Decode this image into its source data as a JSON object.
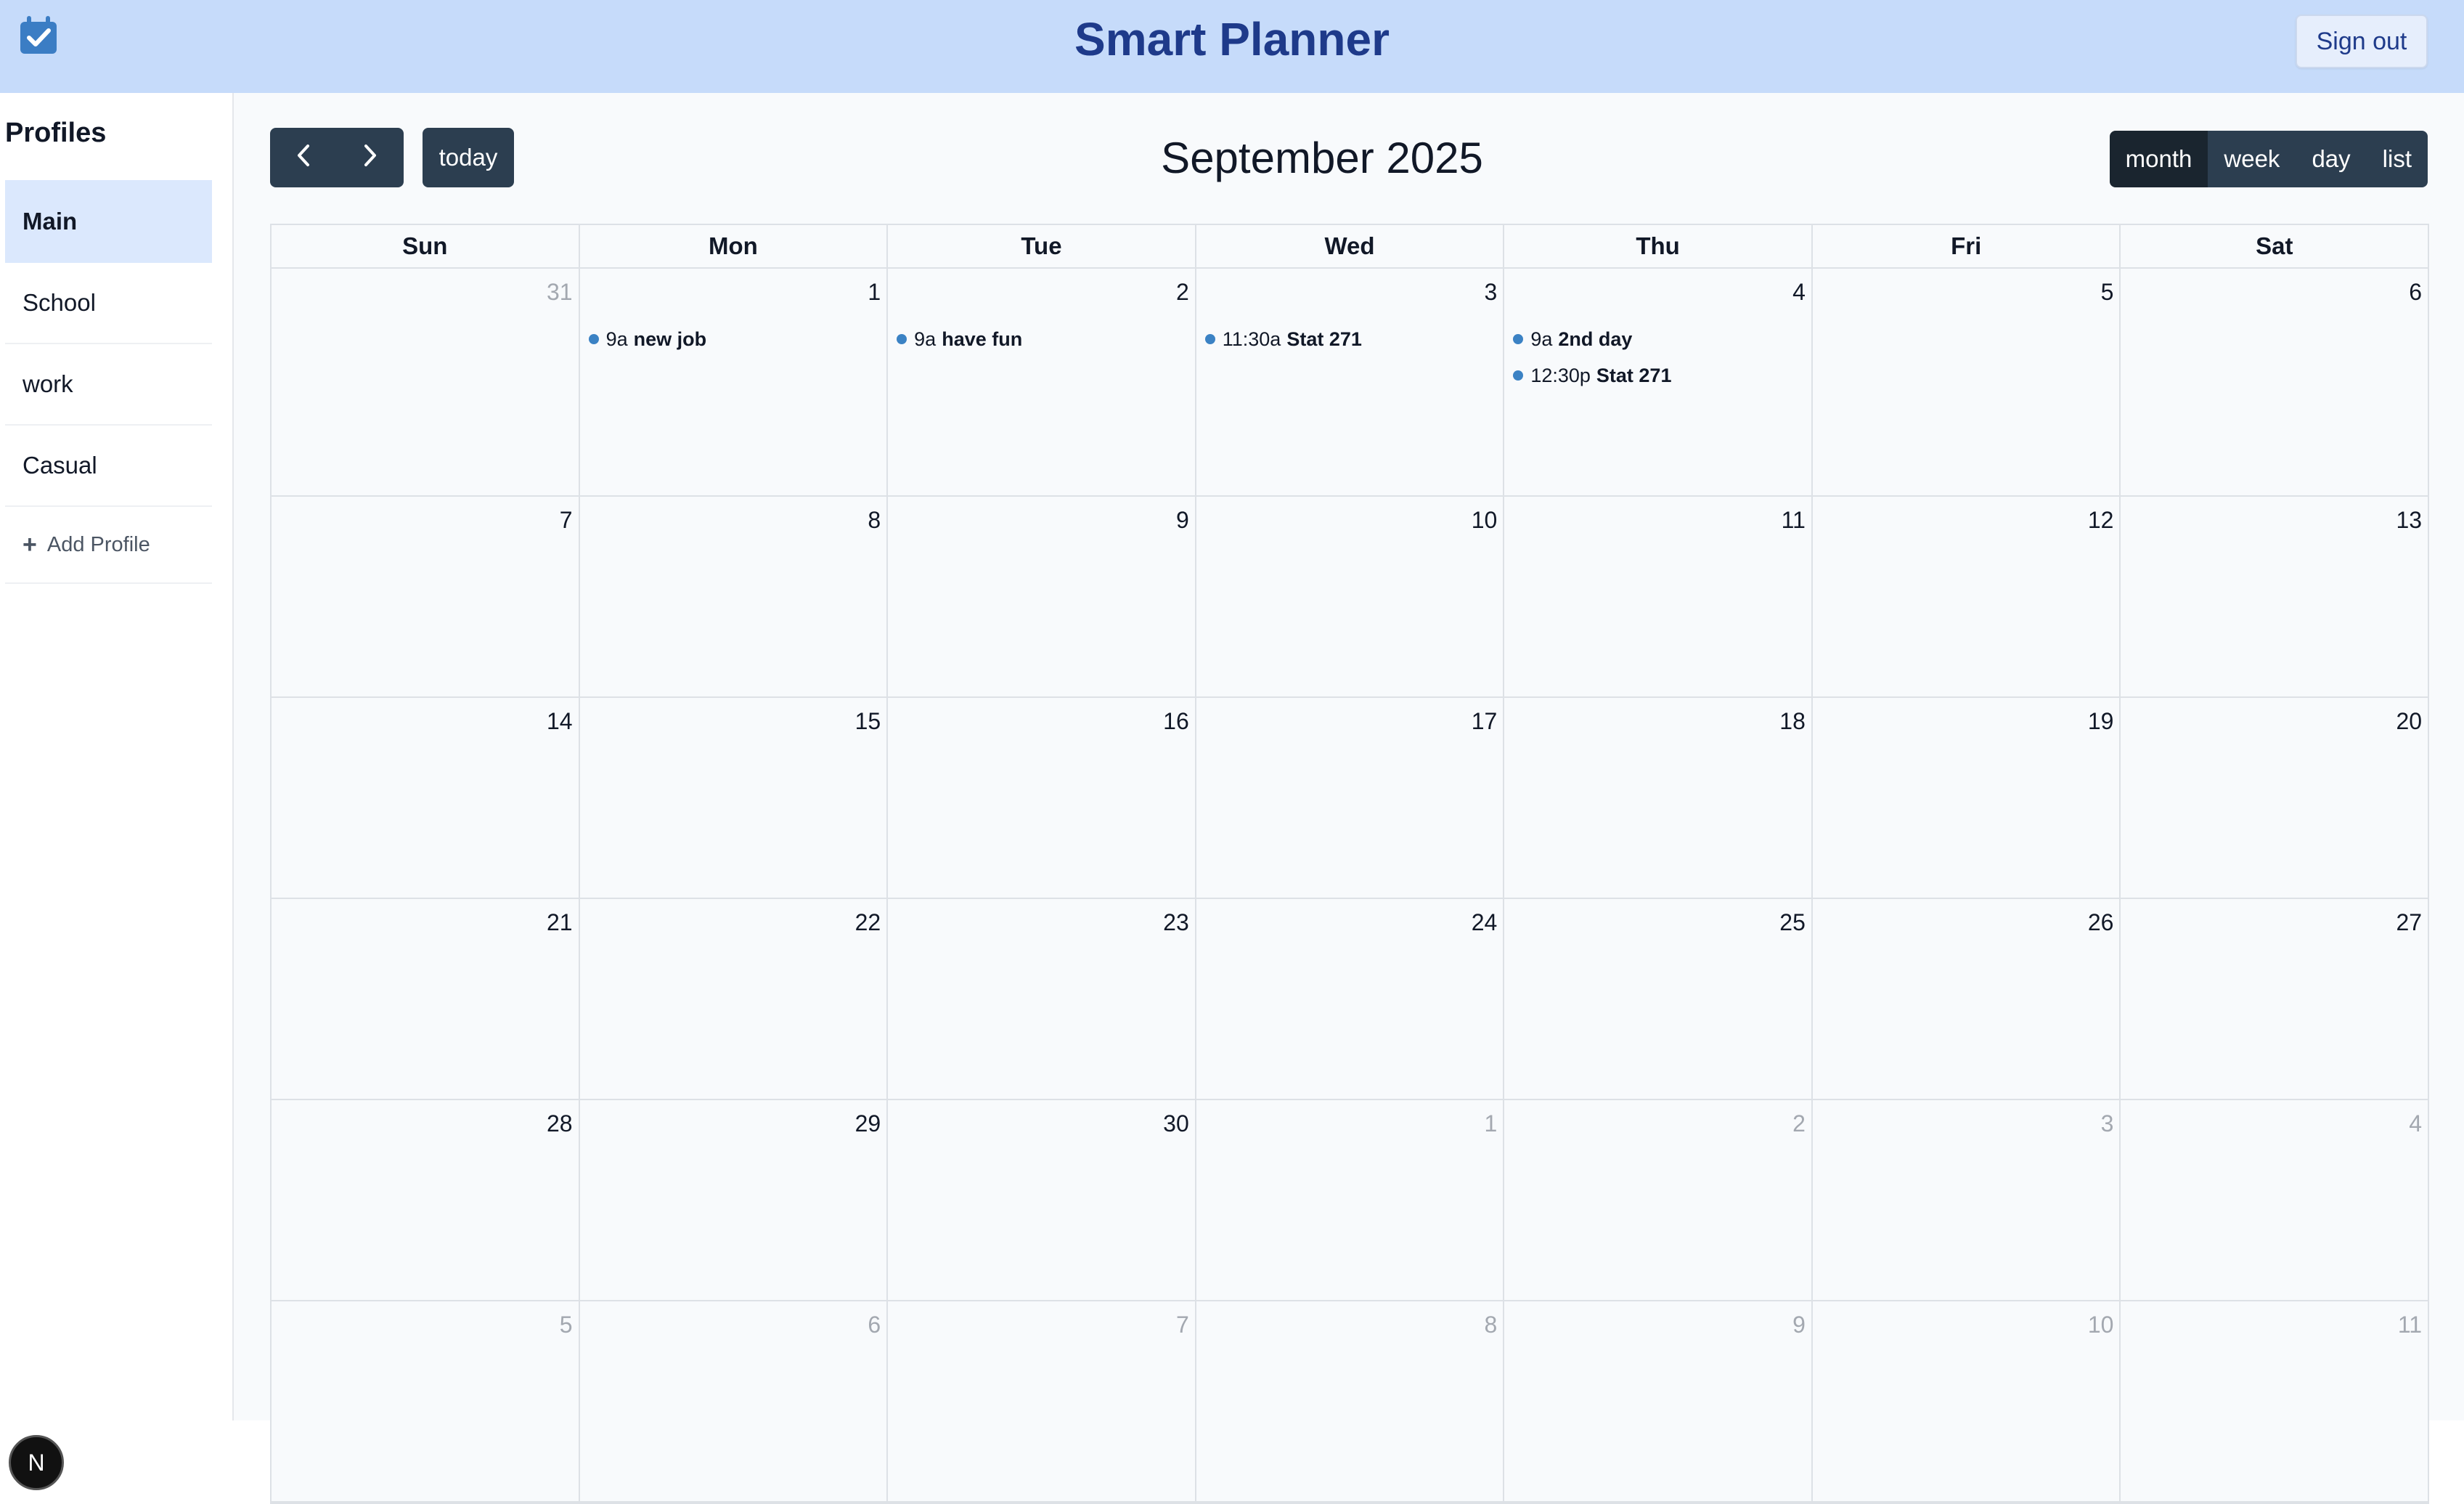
{
  "app": {
    "title": "Smart Planner",
    "logo_icon": "calendar-check-icon",
    "sign_out_label": "Sign out",
    "accent_color": "#1e3a8a",
    "header_bg": "#c6dbfa"
  },
  "sidebar": {
    "title": "Profiles",
    "items": [
      {
        "label": "Main",
        "active": true
      },
      {
        "label": "School",
        "active": false
      },
      {
        "label": "work",
        "active": false
      },
      {
        "label": "Casual",
        "active": false
      }
    ],
    "add_label": "Add Profile",
    "add_icon": "plus-icon",
    "badge_letter": "N"
  },
  "calendar": {
    "title": "September 2025",
    "prev_icon": "chevron-left-icon",
    "next_icon": "chevron-right-icon",
    "today_label": "today",
    "views": [
      {
        "label": "month",
        "active": true
      },
      {
        "label": "week",
        "active": false
      },
      {
        "label": "day",
        "active": false
      },
      {
        "label": "list",
        "active": false
      }
    ],
    "days_of_week": [
      "Sun",
      "Mon",
      "Tue",
      "Wed",
      "Thu",
      "Fri",
      "Sat"
    ],
    "event_dot_color": "#3b82c4",
    "weeks": [
      [
        {
          "num": "31",
          "other": true,
          "events": []
        },
        {
          "num": "1",
          "other": false,
          "events": [
            {
              "time": "9a",
              "title": "new job"
            }
          ]
        },
        {
          "num": "2",
          "other": false,
          "events": [
            {
              "time": "9a",
              "title": "have fun"
            }
          ]
        },
        {
          "num": "3",
          "other": false,
          "events": [
            {
              "time": "11:30a",
              "title": "Stat 271"
            }
          ]
        },
        {
          "num": "4",
          "other": false,
          "events": [
            {
              "time": "9a",
              "title": "2nd day"
            },
            {
              "time": "12:30p",
              "title": "Stat 271"
            }
          ]
        },
        {
          "num": "5",
          "other": false,
          "events": []
        },
        {
          "num": "6",
          "other": false,
          "events": []
        }
      ],
      [
        {
          "num": "7",
          "other": false,
          "events": []
        },
        {
          "num": "8",
          "other": false,
          "events": []
        },
        {
          "num": "9",
          "other": false,
          "events": []
        },
        {
          "num": "10",
          "other": false,
          "events": []
        },
        {
          "num": "11",
          "other": false,
          "events": []
        },
        {
          "num": "12",
          "other": false,
          "events": []
        },
        {
          "num": "13",
          "other": false,
          "events": []
        }
      ],
      [
        {
          "num": "14",
          "other": false,
          "events": []
        },
        {
          "num": "15",
          "other": false,
          "events": []
        },
        {
          "num": "16",
          "other": false,
          "events": []
        },
        {
          "num": "17",
          "other": false,
          "events": []
        },
        {
          "num": "18",
          "other": false,
          "events": []
        },
        {
          "num": "19",
          "other": false,
          "events": []
        },
        {
          "num": "20",
          "other": false,
          "events": []
        }
      ],
      [
        {
          "num": "21",
          "other": false,
          "events": []
        },
        {
          "num": "22",
          "other": false,
          "events": []
        },
        {
          "num": "23",
          "other": false,
          "events": []
        },
        {
          "num": "24",
          "other": false,
          "events": []
        },
        {
          "num": "25",
          "other": false,
          "events": []
        },
        {
          "num": "26",
          "other": false,
          "events": []
        },
        {
          "num": "27",
          "other": false,
          "events": []
        }
      ],
      [
        {
          "num": "28",
          "other": false,
          "events": []
        },
        {
          "num": "29",
          "other": false,
          "events": []
        },
        {
          "num": "30",
          "other": false,
          "events": []
        },
        {
          "num": "1",
          "other": true,
          "events": []
        },
        {
          "num": "2",
          "other": true,
          "events": []
        },
        {
          "num": "3",
          "other": true,
          "events": []
        },
        {
          "num": "4",
          "other": true,
          "events": []
        }
      ],
      [
        {
          "num": "5",
          "other": true,
          "events": []
        },
        {
          "num": "6",
          "other": true,
          "events": []
        },
        {
          "num": "7",
          "other": true,
          "events": []
        },
        {
          "num": "8",
          "other": true,
          "events": []
        },
        {
          "num": "9",
          "other": true,
          "events": []
        },
        {
          "num": "10",
          "other": true,
          "events": []
        },
        {
          "num": "11",
          "other": true,
          "events": []
        }
      ]
    ]
  }
}
